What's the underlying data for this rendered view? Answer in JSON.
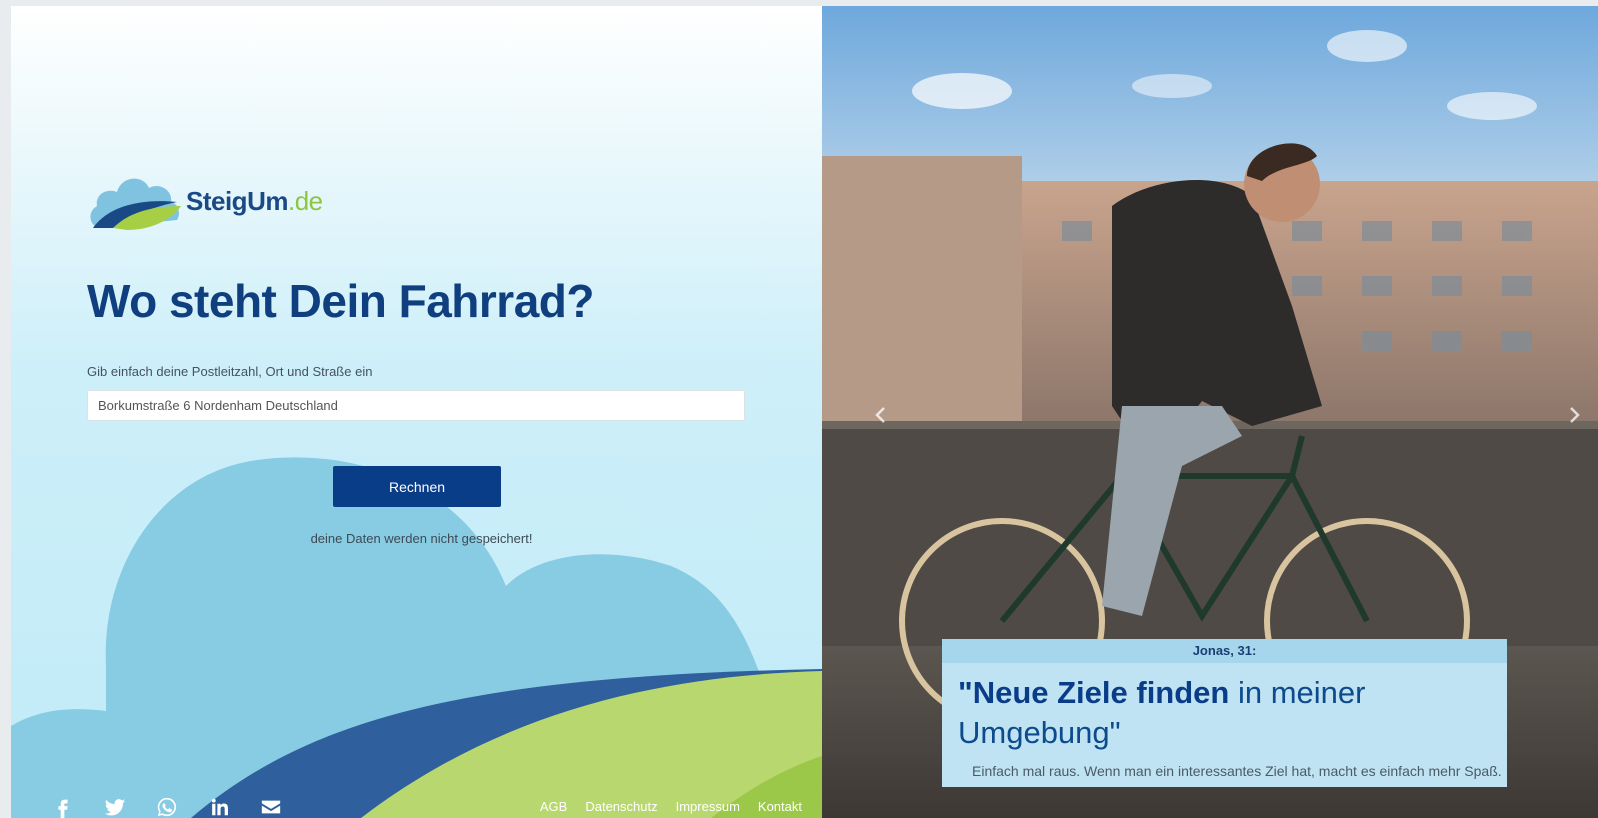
{
  "brand": {
    "name": "SteigUm",
    "tld": ".de"
  },
  "form": {
    "headline": "Wo steht Dein Fahrrad?",
    "hint": "Gib einfach deine Postleitzahl, Ort und Straße ein",
    "address_value": "Borkumstraße 6 Nordenham Deutschland",
    "submit_label": "Rechnen",
    "privacy_note": "deine Daten werden nicht gespeichert!"
  },
  "social": [
    "facebook-icon",
    "twitter-icon",
    "whatsapp-icon",
    "linkedin-icon",
    "mail-icon"
  ],
  "footer": {
    "links": [
      "AGB",
      "Datenschutz",
      "Impressum",
      "Kontakt"
    ]
  },
  "testimonial": {
    "name": "Jonas, 31:",
    "quote_bold": "\"Neue Ziele finden",
    "quote_rest": " in meiner Umgebung\"",
    "subtext": "Einfach mal raus. Wenn man ein interessantes Ziel hat, macht es einfach mehr Spaß."
  },
  "carousel": {
    "prev_icon": "chevron-left-icon",
    "next_icon": "chevron-right-icon"
  },
  "colors": {
    "navy": "#0a3d88",
    "green": "#8dc63f",
    "sky": "#87cce3",
    "quote_bg": "#bfe3f3"
  }
}
